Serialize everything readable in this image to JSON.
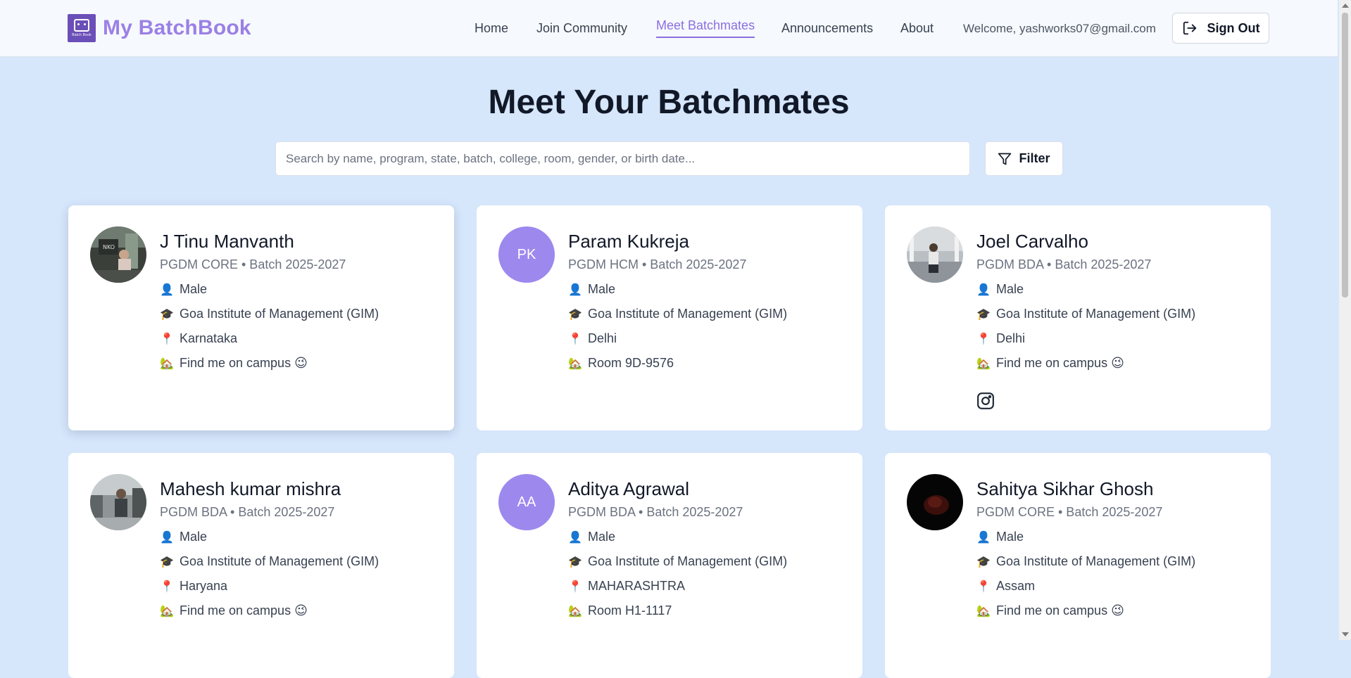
{
  "header": {
    "brand": "My BatchBook",
    "logo_text": "Batch Book",
    "nav": [
      {
        "label": "Home",
        "active": false
      },
      {
        "label": "Join Community",
        "active": false
      },
      {
        "label": "Meet Batchmates",
        "active": true
      },
      {
        "label": "Announcements",
        "active": false
      },
      {
        "label": "About",
        "active": false
      }
    ],
    "welcome": "Welcome, yashworks07@gmail.com",
    "signout_label": "Sign Out"
  },
  "main": {
    "title": "Meet Your Batchmates",
    "search": {
      "placeholder": "Search by name, program, state, batch, college, room, gender, or birth date...",
      "value": ""
    },
    "filter_label": "Filter"
  },
  "colors": {
    "accent": "#8c6fe0",
    "background": "#d6e6fb",
    "initials_bg": "#9d88ee"
  },
  "cards": [
    {
      "name": "J Tinu Manvanth",
      "meta": "PGDM CORE • Batch 2025-2027",
      "gender": "Male",
      "college": "Goa Institute of Management (GIM)",
      "state": "Karnataka",
      "room": "Find me on campus 😉",
      "avatar": "photo",
      "initials": "",
      "instagram": false
    },
    {
      "name": "Param Kukreja",
      "meta": "PGDM HCM • Batch 2025-2027",
      "gender": "Male",
      "college": "Goa Institute of Management (GIM)",
      "state": "Delhi",
      "room": "Room 9D-9576",
      "avatar": "initials",
      "initials": "PK",
      "instagram": false
    },
    {
      "name": "Joel Carvalho",
      "meta": "PGDM BDA • Batch 2025-2027",
      "gender": "Male",
      "college": "Goa Institute of Management (GIM)",
      "state": "Delhi",
      "room": "Find me on campus 😉",
      "avatar": "photo",
      "initials": "",
      "instagram": true
    },
    {
      "name": "Mahesh kumar mishra",
      "meta": "PGDM BDA • Batch 2025-2027",
      "gender": "Male",
      "college": "Goa Institute of Management (GIM)",
      "state": "Haryana",
      "room": "Find me on campus 😉",
      "avatar": "photo",
      "initials": "",
      "instagram": false
    },
    {
      "name": "Aditya Agrawal",
      "meta": "PGDM BDA • Batch 2025-2027",
      "gender": "Male",
      "college": "Goa Institute of Management (GIM)",
      "state": "MAHARASHTRA",
      "room": "Room H1-1117",
      "avatar": "initials",
      "initials": "AA",
      "instagram": false
    },
    {
      "name": "Sahitya Sikhar Ghosh",
      "meta": "PGDM CORE • Batch 2025-2027",
      "gender": "Male",
      "college": "Goa Institute of Management (GIM)",
      "state": "Assam",
      "room": "Find me on campus 😉",
      "avatar": "photo",
      "initials": "",
      "instagram": false
    }
  ],
  "icons": {
    "gender": "person-icon",
    "college": "graduation-cap-icon",
    "state": "location-pin-icon",
    "room": "house-icon",
    "social": "instagram-icon"
  }
}
